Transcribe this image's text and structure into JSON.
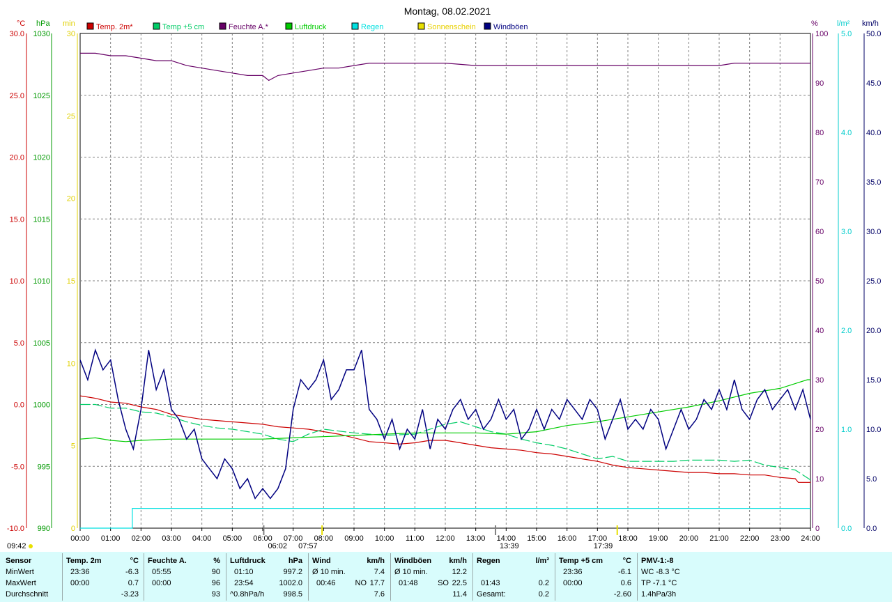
{
  "chart_data": {
    "type": "line",
    "title": "Montag, 08.02.2021",
    "x_ticks": [
      "00:00",
      "01:00",
      "02:00",
      "03:00",
      "04:00",
      "05:00",
      "06:00",
      "07:00",
      "08:00",
      "09:00",
      "10:00",
      "11:00",
      "12:00",
      "13:00",
      "14:00",
      "15:00",
      "16:00",
      "17:00",
      "18:00",
      "19:00",
      "20:00",
      "21:00",
      "22:00",
      "23:00",
      "24:00"
    ],
    "axes": {
      "temp_c": {
        "unit": "°C",
        "range": [
          -10,
          30
        ],
        "ticks": [
          "30.0",
          "25.0",
          "20.0",
          "15.0",
          "10.0",
          "5.0",
          "0.0",
          "-5.0",
          "-10.0"
        ],
        "color": "#cc0000"
      },
      "pressure_hpa": {
        "unit": "hPa",
        "range": [
          990,
          1030
        ],
        "ticks": [
          "1030",
          "1025",
          "1020",
          "1015",
          "1010",
          "1005",
          "1000",
          "995",
          "990"
        ],
        "color": "#009900"
      },
      "sunshine_min": {
        "unit": "min",
        "range": [
          0,
          30
        ],
        "ticks": [
          "30",
          "25",
          "20",
          "15",
          "10",
          "5",
          "0"
        ],
        "color": "#e0d000"
      },
      "humidity_pct": {
        "unit": "%",
        "range": [
          0,
          100
        ],
        "ticks": [
          "100",
          "90",
          "80",
          "70",
          "60",
          "50",
          "40",
          "30",
          "20",
          "10",
          "0"
        ],
        "color": "#660066"
      },
      "rain_lm2": {
        "unit": "l/m²",
        "range": [
          0,
          5
        ],
        "ticks": [
          "5.0",
          "4.0",
          "3.0",
          "2.0",
          "1.0",
          "0.0"
        ],
        "color": "#00cccc"
      },
      "wind_kmh": {
        "unit": "km/h",
        "range": [
          0,
          50
        ],
        "ticks": [
          "50.0",
          "45.0",
          "40.0",
          "35.0",
          "30.0",
          "25.0",
          "20.0",
          "15.0",
          "10.0",
          "5.0",
          "0.0"
        ],
        "color": "#000066"
      }
    },
    "legend": [
      {
        "name": "Temp. 2m*",
        "color": "#cc0000"
      },
      {
        "name": "Temp +5 cm",
        "color": "#00cc66"
      },
      {
        "name": "Feuchte A.*",
        "color": "#660066"
      },
      {
        "name": "Luftdruck",
        "color": "#00cc00"
      },
      {
        "name": "Regen",
        "color": "#00e0e0"
      },
      {
        "name": "Sonnenschein",
        "color": "#e8e000"
      },
      {
        "name": "Windböen",
        "color": "#000080"
      }
    ],
    "series": [
      {
        "name": "Temp. 2m*",
        "axis": "temp_c",
        "color": "#cc0000",
        "x": [
          0,
          0.5,
          1,
          1.5,
          2,
          2.5,
          3,
          3.5,
          4,
          4.5,
          5,
          5.5,
          6,
          6.5,
          7,
          7.5,
          8,
          8.5,
          9,
          9.5,
          10,
          10.5,
          11,
          11.5,
          12,
          12.5,
          13,
          13.5,
          14,
          14.5,
          15,
          15.5,
          16,
          16.5,
          17,
          17.5,
          18,
          18.5,
          19,
          19.5,
          20,
          20.5,
          21,
          21.5,
          22,
          22.5,
          23,
          23.5,
          23.6,
          24
        ],
        "y": [
          0.7,
          0.5,
          0.2,
          0.1,
          -0.2,
          -0.4,
          -0.8,
          -1.0,
          -1.2,
          -1.3,
          -1.4,
          -1.5,
          -1.6,
          -1.8,
          -1.9,
          -2.0,
          -2.2,
          -2.4,
          -2.7,
          -3.0,
          -3.1,
          -3.2,
          -3.1,
          -2.9,
          -2.9,
          -3.1,
          -3.3,
          -3.5,
          -3.6,
          -3.7,
          -3.9,
          -4.0,
          -4.2,
          -4.4,
          -4.6,
          -4.9,
          -5.1,
          -5.2,
          -5.3,
          -5.4,
          -5.5,
          -5.5,
          -5.6,
          -5.6,
          -5.7,
          -5.7,
          -5.9,
          -6.0,
          -6.3,
          -6.3
        ]
      },
      {
        "name": "Temp +5 cm",
        "axis": "temp_c",
        "color": "#00cc66",
        "x": [
          0,
          0.5,
          1,
          1.5,
          2,
          2.5,
          3,
          3.5,
          4,
          4.5,
          5,
          5.5,
          6,
          6.5,
          7,
          7.5,
          8,
          9,
          10,
          11,
          12,
          12.5,
          13,
          13.5,
          14,
          14.5,
          15,
          15.5,
          16,
          16.5,
          17,
          17.5,
          18,
          18.5,
          19,
          19.5,
          20,
          20.5,
          21,
          21.5,
          22,
          22.5,
          23,
          23.5,
          24
        ],
        "y": [
          0.0,
          0.0,
          -0.3,
          -0.3,
          -0.6,
          -0.7,
          -1.0,
          -1.4,
          -1.7,
          -1.9,
          -2.0,
          -2.2,
          -2.4,
          -2.8,
          -3.0,
          -2.4,
          -2.0,
          -2.3,
          -2.5,
          -2.4,
          -1.6,
          -1.4,
          -1.8,
          -2.2,
          -2.4,
          -2.8,
          -3.1,
          -3.3,
          -3.6,
          -4.0,
          -4.4,
          -4.2,
          -4.6,
          -4.6,
          -4.6,
          -4.6,
          -4.5,
          -4.5,
          -4.5,
          -4.6,
          -4.5,
          -4.9,
          -5.1,
          -5.3,
          -6.1
        ]
      },
      {
        "name": "Feuchte A.*",
        "axis": "humidity_pct",
        "color": "#660066",
        "x": [
          0,
          0.5,
          1,
          1.5,
          2,
          2.5,
          3,
          3.5,
          4,
          4.5,
          5,
          5.5,
          6,
          6.2,
          6.5,
          7,
          7.5,
          8,
          8.5,
          9,
          9.5,
          10,
          11,
          12,
          13,
          14,
          15,
          16,
          17,
          18,
          19,
          20,
          21,
          21.5,
          22,
          23,
          24
        ],
        "y": [
          96,
          96,
          95.5,
          95.5,
          95,
          94.5,
          94.5,
          93.5,
          93,
          92.5,
          92,
          91.5,
          91.5,
          90.5,
          91.5,
          92,
          92.5,
          93,
          93,
          93.5,
          94,
          94,
          94,
          94,
          93.5,
          93.5,
          93.5,
          93.5,
          93.5,
          93.5,
          93.5,
          93.5,
          93.5,
          94,
          94,
          94,
          94
        ]
      },
      {
        "name": "Luftdruck",
        "axis": "pressure_hpa",
        "color": "#00cc00",
        "x": [
          0,
          0.5,
          1,
          1.5,
          2,
          3,
          4,
          5,
          6,
          7,
          8,
          9,
          10,
          11,
          12,
          13,
          14,
          15,
          16,
          17,
          18,
          19,
          20,
          21,
          22,
          23,
          23.9,
          24
        ],
        "y": [
          997.2,
          997.3,
          997.1,
          997.0,
          997.1,
          997.2,
          997.2,
          997.2,
          997.2,
          997.3,
          997.4,
          997.5,
          997.6,
          997.7,
          997.7,
          997.7,
          997.6,
          997.8,
          998.3,
          998.6,
          999.0,
          999.4,
          999.8,
          1000.3,
          1000.9,
          1001.3,
          1002.0,
          1002.0
        ]
      },
      {
        "name": "Regen",
        "axis": "rain_lm2",
        "color": "#00e0e0",
        "x": [
          0,
          1.716,
          1.716,
          24
        ],
        "y": [
          0,
          0,
          0.2,
          0.2
        ]
      },
      {
        "name": "Windböen",
        "axis": "wind_kmh",
        "color": "#000080",
        "x": [
          0,
          0.25,
          0.5,
          0.75,
          1,
          1.25,
          1.5,
          1.75,
          2,
          2.25,
          2.5,
          2.75,
          3,
          3.25,
          3.5,
          3.75,
          4,
          4.25,
          4.5,
          4.75,
          5,
          5.25,
          5.5,
          5.75,
          6,
          6.25,
          6.5,
          6.75,
          7,
          7.25,
          7.5,
          7.75,
          8,
          8.25,
          8.5,
          8.75,
          9,
          9.25,
          9.5,
          9.75,
          10,
          10.25,
          10.5,
          10.75,
          11,
          11.25,
          11.5,
          11.75,
          12,
          12.25,
          12.5,
          12.75,
          13,
          13.25,
          13.5,
          13.75,
          14,
          14.25,
          14.5,
          14.75,
          15,
          15.25,
          15.5,
          15.75,
          16,
          16.25,
          16.5,
          16.75,
          17,
          17.25,
          17.5,
          17.75,
          18,
          18.25,
          18.5,
          18.75,
          19,
          19.25,
          19.5,
          19.75,
          20,
          20.25,
          20.5,
          20.75,
          21,
          21.25,
          21.5,
          21.75,
          22,
          22.25,
          22.5,
          22.75,
          23,
          23.25,
          23.5,
          23.75,
          24
        ],
        "y": [
          17,
          15,
          18,
          16,
          17,
          13,
          10,
          8,
          12,
          18,
          14,
          16,
          12,
          11,
          9,
          10,
          7,
          6,
          5,
          7,
          6,
          4,
          5,
          3,
          4,
          3,
          4,
          6,
          12,
          15,
          14,
          15,
          17,
          13,
          14,
          16,
          16,
          18,
          12,
          11,
          9,
          11,
          8,
          10,
          9,
          12,
          8,
          11,
          10,
          12,
          13,
          11,
          12,
          10,
          11,
          13,
          11,
          12,
          9,
          10,
          12,
          10,
          12,
          11,
          13,
          12,
          11,
          13,
          12,
          9,
          11,
          13,
          10,
          11,
          10,
          12,
          11,
          8,
          10,
          12,
          10,
          11,
          13,
          12,
          14,
          12,
          15,
          12,
          11,
          13,
          14,
          12,
          13,
          14,
          12,
          14,
          11
        ]
      }
    ],
    "markers": [
      {
        "label": "06:02",
        "kind": "sunrise-ish"
      },
      {
        "label": "07:57",
        "kind": "sunrise"
      },
      {
        "label": "13:39",
        "kind": "min"
      },
      {
        "label": "17:39",
        "kind": "sunset"
      },
      {
        "label": "09:42",
        "kind": "sun"
      }
    ]
  },
  "stats": {
    "sensor": {
      "header": "Sensor",
      "rows": [
        "MinWert",
        "MaxWert",
        "Durchschnitt"
      ]
    },
    "temp2m": {
      "header": "Temp. 2m",
      "unit": "°C",
      "min_time": "23:36",
      "min": "-6.3",
      "max_time": "00:00",
      "max": "0.7",
      "avg": "-3.23"
    },
    "feuchte": {
      "header": "Feuchte A.",
      "unit": "%",
      "min_time": "05:55",
      "min": "90",
      "max_time": "00:00",
      "max": "96",
      "avg": "93"
    },
    "luftdruck": {
      "header": "Luftdruck",
      "unit": "hPa",
      "min_time": "01:10",
      "min": "997.2",
      "max_time": "23:54",
      "max": "1002.0",
      "trend": "^0.8hPa/h",
      "avg": "998.5"
    },
    "wind": {
      "header": "Wind",
      "unit": "km/h",
      "sub": "Ø 10 min.",
      "sub_val": "7.4",
      "max_time": "00:46",
      "max_dir": "NO",
      "max": "17.7",
      "avg": "7.6"
    },
    "windboeen": {
      "header": "Windböen",
      "unit": "km/h",
      "sub": "Ø 10 min.",
      "sub_val": "12.2",
      "max_time": "01:48",
      "max_dir": "SO",
      "max": "22.5",
      "avg": "11.4"
    },
    "regen": {
      "header": "Regen",
      "unit": "l/m²",
      "max_time": "01:43",
      "max": "0.2",
      "total_label": "Gesamt:",
      "total": "0.2"
    },
    "temp5cm": {
      "header": "Temp +5 cm",
      "unit": "°C",
      "min_time": "23:36",
      "min": "-6.1",
      "max_time": "00:00",
      "max": "0.6",
      "avg": "-2.60"
    },
    "pmv": {
      "header": "PMV-1:-8",
      "wc": "WC -8.3 °C",
      "tp": "TP -7.1 °C",
      "trend": "1.4hPa/3h"
    }
  }
}
